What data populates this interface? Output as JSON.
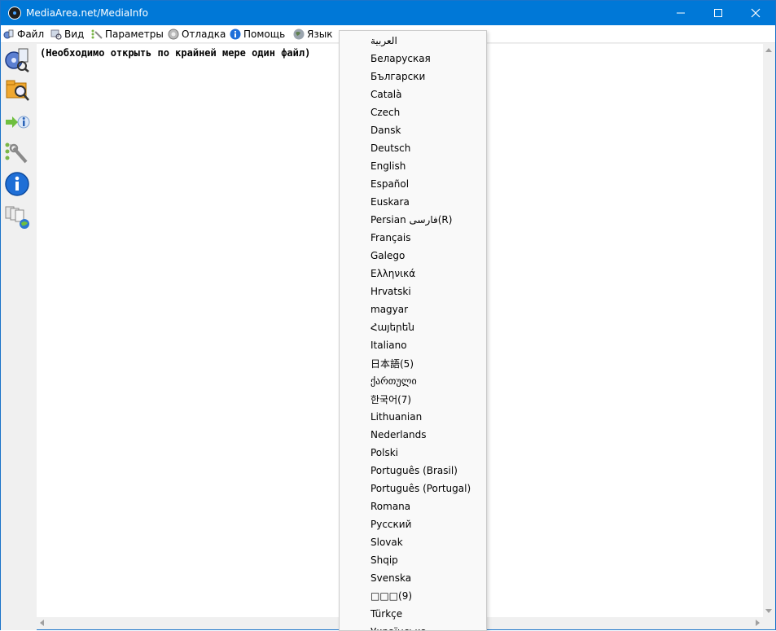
{
  "window": {
    "title": "MediaArea.net/MediaInfo"
  },
  "menubar": {
    "items": [
      {
        "label": "Файл",
        "icon": "file-icon"
      },
      {
        "label": "Вид",
        "icon": "view-icon"
      },
      {
        "label": "Параметры",
        "icon": "options-icon"
      },
      {
        "label": "Отладка",
        "icon": "debug-icon"
      },
      {
        "label": "Помощь",
        "icon": "help-icon"
      },
      {
        "label": "Язык",
        "icon": "globe-icon"
      }
    ]
  },
  "toolbar": {
    "buttons": [
      "open-file-icon",
      "open-folder-icon",
      "export-icon",
      "preferences-icon",
      "about-icon",
      "knowledge-base-icon"
    ]
  },
  "content": {
    "message": "(Необходимо открыть по крайней мере один файл)"
  },
  "language_menu": {
    "items": [
      "العربية",
      "Беларуская",
      "Български",
      "Català",
      "Czech",
      "Dansk",
      "Deutsch",
      "English",
      "Español",
      "Euskara",
      "Persian  فارسی(R)",
      "Français",
      "Galego",
      "Ελληνικά",
      "Hrvatski",
      "magyar",
      "Հայերեն",
      "Italiano",
      "日本語(5)",
      "ქართული",
      "한국어(7)",
      "Lithuanian",
      "Nederlands",
      "Polski",
      "Português (Brasil)",
      "Português (Portugal)",
      "Romana",
      "Русский",
      "Slovak",
      "Shqip",
      "Svenska",
      "□□□(9)",
      "Türkçe",
      "Українська"
    ]
  },
  "colors": {
    "titlebar": "#0078d7",
    "window_bg": "#f0f0f0",
    "menu_bg": "#f9f9f9"
  }
}
